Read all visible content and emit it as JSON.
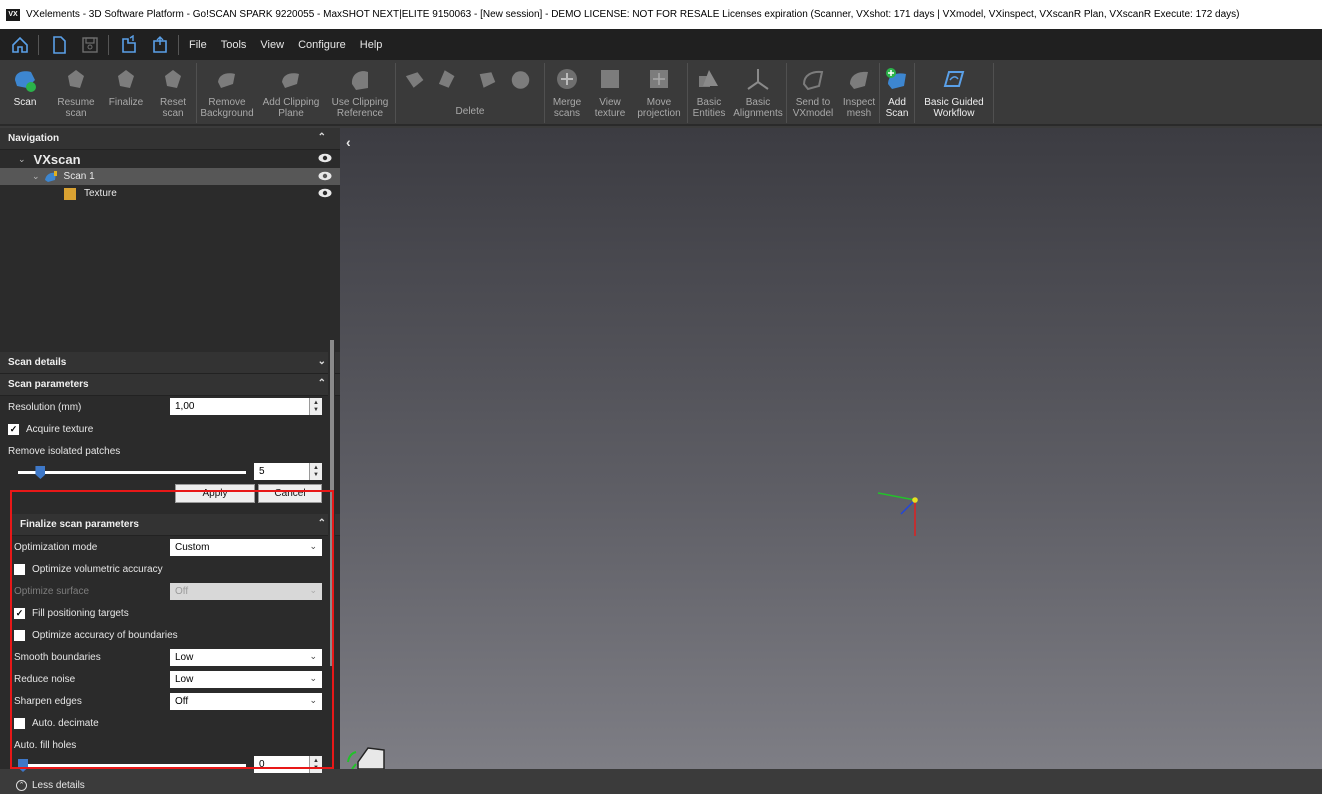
{
  "window": {
    "title": "VXelements - 3D Software Platform - Go!SCAN SPARK 9220055 - MaxSHOT NEXT|ELITE 9150063 - [New session] - DEMO LICENSE: NOT FOR RESALE Licenses expiration (Scanner, VXshot: 171 days | VXmodel, VXinspect, VXscanR Plan, VXscanR Execute: 172 days)",
    "app_icon_text": "VX"
  },
  "menu": [
    "File",
    "Tools",
    "View",
    "Configure",
    "Help"
  ],
  "quick_access_icons": [
    "home-icon",
    "new-icon",
    "save-icon",
    "open-session-icon",
    "save-session-icon"
  ],
  "ribbon": {
    "scan": "Scan",
    "resume_scan": "Resume\nscan",
    "finalize": "Finalize",
    "reset_scan": "Reset\nscan",
    "remove_background": "Remove\nBackground",
    "add_clipping_plane": "Add Clipping\nPlane",
    "use_clipping_reference": "Use Clipping\nReference",
    "delete": "Delete",
    "merge_scans": "Merge\nscans",
    "view_texture": "View\ntexture",
    "move_projection": "Move\nprojection",
    "basic_entities": "Basic\nEntities",
    "basic_alignments": "Basic\nAlignments",
    "send_to_vxmodel": "Send to\nVXmodel",
    "inspect_mesh": "Inspect\nmesh",
    "add_scan": "Add\nScan",
    "basic_guided_workflow": "Basic Guided\nWorkflow"
  },
  "navigation": {
    "header": "Navigation",
    "root": "VXscan",
    "scan": "Scan 1",
    "texture": "Texture"
  },
  "scan_details": {
    "header": "Scan details"
  },
  "scan_parameters": {
    "header": "Scan parameters",
    "resolution_label": "Resolution (mm)",
    "resolution_value": "1,00",
    "acquire_texture": "Acquire texture",
    "acquire_texture_checked": true,
    "remove_isolated_label": "Remove isolated patches",
    "remove_isolated_value": "5",
    "remove_isolated_level": 0.08,
    "apply": "Apply",
    "cancel": "Cancel"
  },
  "finalize": {
    "header": "Finalize scan parameters",
    "optimization_mode_label": "Optimization mode",
    "optimization_mode_value": "Custom",
    "optimize_volumetric": "Optimize volumetric accuracy",
    "optimize_surface_label": "Optimize surface",
    "optimize_surface_value": "Off",
    "fill_targets": "Fill positioning targets",
    "optimize_boundaries": "Optimize accuracy of boundaries",
    "smooth_boundaries_label": "Smooth boundaries",
    "smooth_boundaries_value": "Low",
    "reduce_noise_label": "Reduce noise",
    "reduce_noise_value": "Low",
    "sharpen_edges_label": "Sharpen edges",
    "sharpen_edges_value": "Off",
    "auto_decimate": "Auto. decimate",
    "auto_fill_holes_label": "Auto. fill holes",
    "auto_fill_holes_value": "0",
    "auto_fill_holes_level": 0.0,
    "less_details": "Less details"
  },
  "colors": {
    "accent_blue": "#3e78c8",
    "highlight_red": "#e81818",
    "panel_bg": "#2b2b2b",
    "viewport_top": "#3c3c42",
    "viewport_bottom": "#7e7e85"
  }
}
